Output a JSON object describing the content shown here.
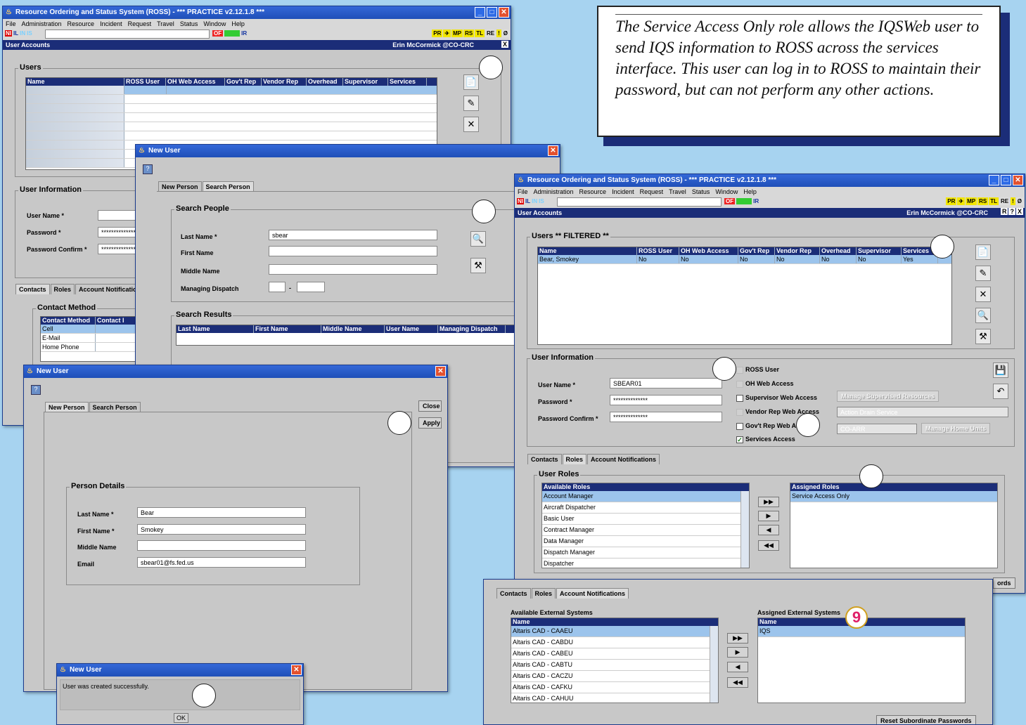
{
  "main_window": {
    "title": "Resource Ordering and Status System (ROSS) - *** PRACTICE v2.12.1.8 ***",
    "menu": [
      "File",
      "Administration",
      "Resource",
      "Incident",
      "Request",
      "Travel",
      "Status",
      "Window",
      "Help"
    ],
    "toolbar_left": [
      "NI",
      "IL",
      "IN",
      "IS"
    ],
    "toolbar_mid": [
      "OF",
      "IR"
    ],
    "toolbar_right": [
      "PR",
      "MP",
      "RS",
      "TL",
      "RE",
      "!",
      "Ø"
    ],
    "section": "User Accounts",
    "user": "Erin McCormick @CO-CRC",
    "users_group": "Users",
    "users_columns": [
      "Name",
      "ROSS User",
      "OH Web Access",
      "Gov't Rep",
      "Vendor Rep",
      "Overhead",
      "Supervisor",
      "Services"
    ],
    "user_info_group": "User Information",
    "labels": {
      "user_name": "User Name *",
      "password": "Password *",
      "password_confirm": "Password Confirm *"
    },
    "password_value": "***************",
    "tabs": [
      "Contacts",
      "Roles",
      "Account Notificatio"
    ],
    "contact_group": "Contact Method",
    "contact_columns": [
      "Contact Method",
      "Contact I"
    ],
    "contact_rows": [
      "Cell",
      "E-Mail",
      "Home Phone"
    ]
  },
  "search_window": {
    "title": "New User",
    "tabs": [
      "New Person",
      "Search Person"
    ],
    "search_group": "Search People",
    "labels": {
      "last_name": "Last Name *",
      "first_name": "First Name",
      "middle_name": "Middle Name",
      "managing_dispatch": "Managing Dispatch"
    },
    "last_name_value": "sbear",
    "dash": "-",
    "results_group": "Search Results",
    "results_columns": [
      "Last Name",
      "First Name",
      "Middle Name",
      "User Name",
      "Managing Dispatch"
    ]
  },
  "new_person_window": {
    "title": "New User",
    "tabs": [
      "New Person",
      "Search Person"
    ],
    "close_label": "Close",
    "apply_label": "Apply",
    "details_group": "Person Details",
    "labels": {
      "last_name": "Last Name *",
      "first_name": "First Name *",
      "middle_name": "Middle Name",
      "email": "Email"
    },
    "values": {
      "last_name": "Bear",
      "first_name": "Smokey",
      "middle_name": "",
      "email": "sbear01@fs.fed.us"
    }
  },
  "confirm_dialog": {
    "title": "New User",
    "message": "User was created successfully.",
    "ok_label": "OK"
  },
  "callout": {
    "text": "The Service Access Only role allows the IQSWeb user to send IQS information to ROSS across the services interface.  This user can log in to ROSS to maintain their password, but can not perform any other actions."
  },
  "filtered_window": {
    "title": "Resource Ordering and Status System (ROSS) - *** PRACTICE v2.12.1.8 ***",
    "menu": [
      "File",
      "Administration",
      "Resource",
      "Incident",
      "Request",
      "Travel",
      "Status",
      "Window",
      "Help"
    ],
    "toolbar_right": [
      "PR",
      "MP",
      "RS",
      "TL",
      "RE",
      "!",
      "Ø"
    ],
    "section": "User Accounts",
    "user": "Erin McCormick @CO-CRC",
    "right_btns": [
      "R",
      "?",
      "X"
    ],
    "users_group": "Users ** FILTERED **",
    "columns": [
      "Name",
      "ROSS User",
      "OH Web Access",
      "Gov't Rep",
      "Vendor Rep",
      "Overhead",
      "Supervisor",
      "Services"
    ],
    "row": [
      "Bear, Smokey",
      "No",
      "No",
      "No",
      "No",
      "No",
      "No",
      "Yes"
    ],
    "user_info_group": "User Information",
    "labels": {
      "user_name": "User Name *",
      "password": "Password *",
      "password_confirm": "Password Confirm *"
    },
    "user_name_value": "SBEAR01",
    "password_value": "**************",
    "checkboxes": [
      "ROSS User",
      "OH Web Access",
      "Supervisor Web Access",
      "Vendor Rep Web Access",
      "Gov't Rep Web Access",
      "Services Access"
    ],
    "manage_supervised": "Manage Supervised Resources",
    "vendor_select": "Action Drain Service",
    "unit_select": "CO-ARR",
    "manage_home_units": "Manage Home Units",
    "tabs": [
      "Contacts",
      "Roles",
      "Account Notifications"
    ],
    "roles_group": "User Roles",
    "available_roles_header": "Available Roles",
    "available_roles": [
      "Account Manager",
      "Aircraft Dispatcher",
      "Basic User",
      "Contract Manager",
      "Data Manager",
      "Dispatch Manager",
      "Dispatcher"
    ],
    "assigned_roles_header": "Assigned Roles",
    "assigned_roles": [
      "Service Access Only"
    ],
    "partial_button": "ords"
  },
  "notifications_window": {
    "tabs": [
      "Contacts",
      "Roles",
      "Account Notifications"
    ],
    "available_label": "Available External Systems",
    "name_header": "Name",
    "available": [
      "Altaris CAD - CAAEU",
      "Altaris CAD - CABDU",
      "Altaris CAD - CABEU",
      "Altaris CAD - CABTU",
      "Altaris CAD - CACZU",
      "Altaris CAD - CAFKU",
      "Altaris CAD - CAHUU"
    ],
    "assigned_label": "Assigned External Systems",
    "assigned": [
      "IQS"
    ],
    "badge": "9",
    "reset_button": "Reset Subordinate Passwords"
  },
  "colors": {
    "background": "#a7d3f0",
    "titlebar": "#2458c8",
    "header": "#1b2d78",
    "selection": "#9cc4ec"
  }
}
